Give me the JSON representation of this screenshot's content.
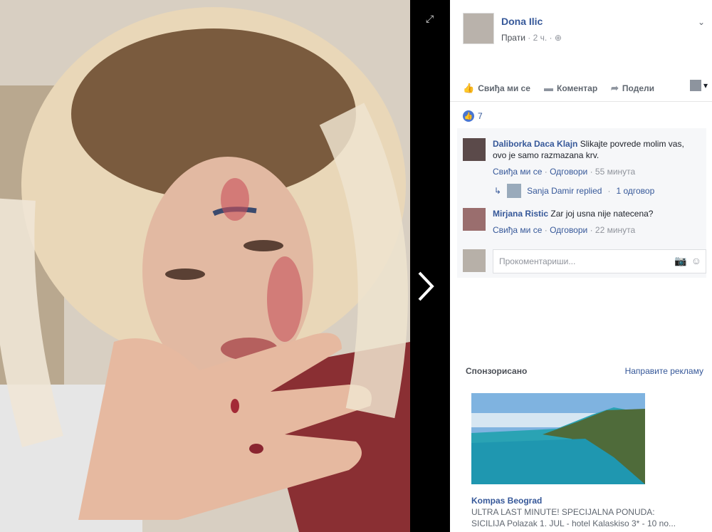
{
  "post": {
    "author": "Dona Ilic",
    "follow": "Прати",
    "time": "2 ч.",
    "privacy_icon": "globe-icon"
  },
  "actions": {
    "like": "Свиђа ми се",
    "comment": "Коментар",
    "share": "Подели"
  },
  "reactions": {
    "count": "7"
  },
  "comments": [
    {
      "name": "Daliborka Daca Klajn",
      "text": "Slikajte povrede molim vas, ovo je samo razmazana krv.",
      "like": "Свиђа ми се",
      "reply": "Одговори",
      "time": "55 минута"
    },
    {
      "name": "Mirjana Ristic",
      "text": "Zar joj usna nije natecena?",
      "like": "Свиђа ми се",
      "reply": "Одговори",
      "time": "22 минута"
    }
  ],
  "reply_summary": {
    "who": "Sanja Damir replied",
    "count": "1 одговор"
  },
  "compose": {
    "placeholder": "Прокоментариши..."
  },
  "sidebar": {
    "sponsored": "Спонзорисано",
    "create_ad": "Направите рекламу",
    "ad_title": "Kompas Beograd",
    "ad_text_1": "ULTRA LAST MINUTE! SPECIJALNA PONUDA:",
    "ad_text_2": "SICILIJA Polazak 1. JUL - hotel Kalaskiso 3* - 10 no..."
  }
}
